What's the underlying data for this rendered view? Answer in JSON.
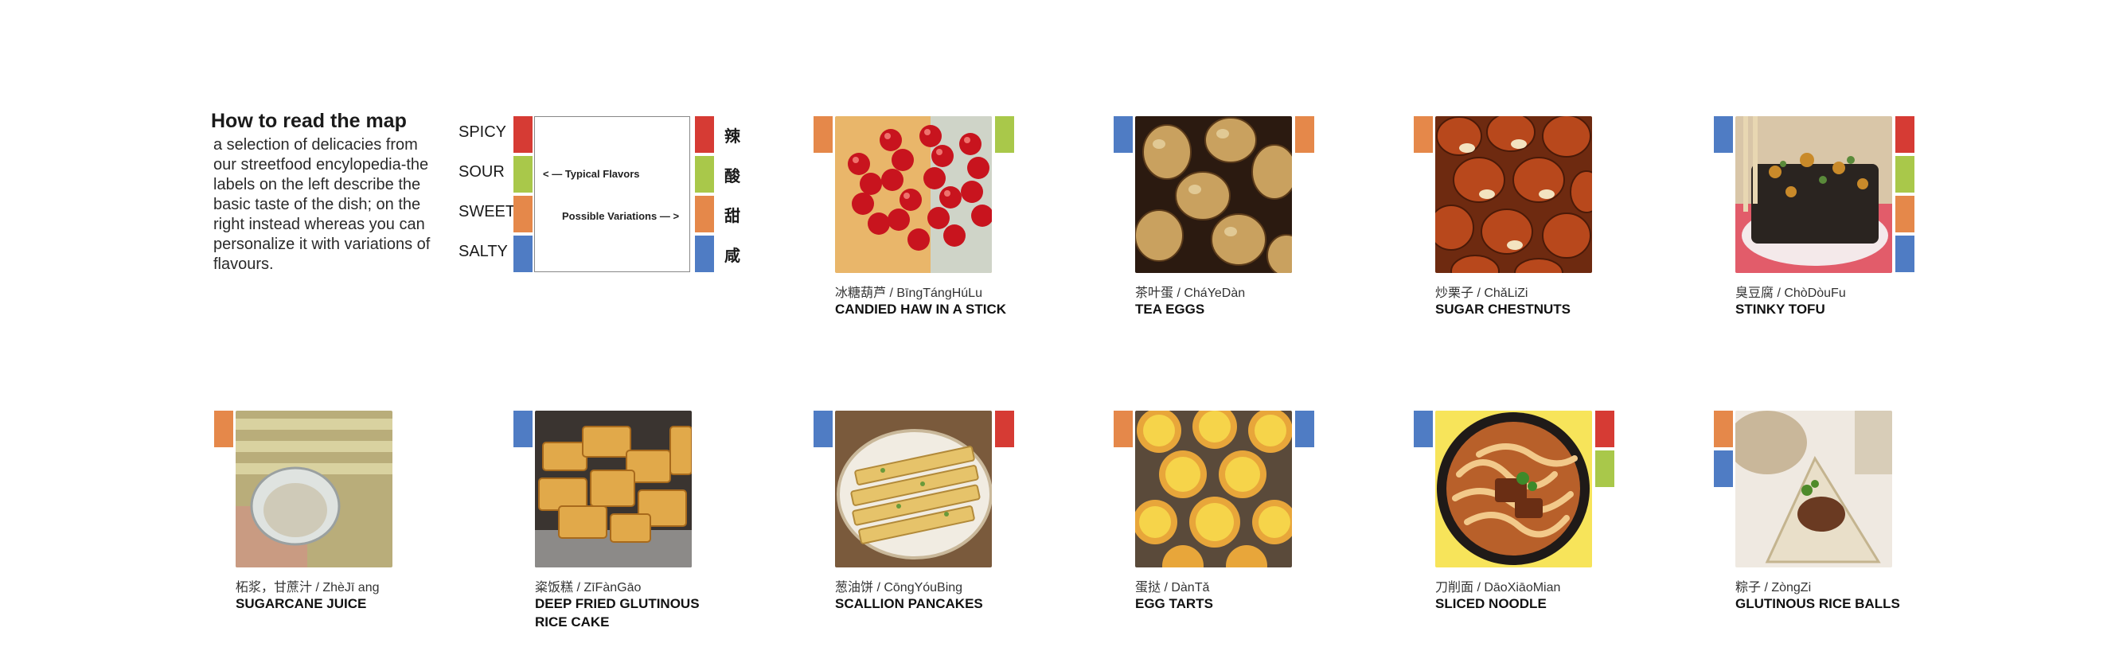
{
  "legend": {
    "title": "How to read the map",
    "description": "a selection of delicacies from our streetfood encylopedia-the labels on the left describe the basic taste of the dish; on the right instead whereas you can personalize it with variations of flavours.",
    "flavors": [
      "SPICY",
      "SOUR",
      "SWEET",
      "SALTY"
    ],
    "typical_label": "< — Typical Flavors",
    "variation_label": "Possible Variations — >",
    "chinese_chars": [
      "辣",
      "酸",
      "甜",
      "咸"
    ]
  },
  "colors": {
    "spicy": "#d63b34",
    "sour": "#a9c84a",
    "sweet": "#e5884a",
    "salty": "#4f7cc4"
  },
  "foods": [
    {
      "cn": "冰糖葫芦 / BīngTángHúLu",
      "en": "CANDIED HAW IN A STICK",
      "typical": [
        "sweet"
      ],
      "variations": [
        "sour"
      ],
      "image": "candied-haw-photo"
    },
    {
      "cn": "茶叶蛋 / CháYeDàn",
      "en": "TEA EGGS",
      "typical": [
        "salty"
      ],
      "variations": [
        "sweet"
      ],
      "image": "tea-eggs-photo"
    },
    {
      "cn": "炒栗子 / ChǎLiZi",
      "en": "SUGAR CHESTNUTS",
      "typical": [
        "sweet"
      ],
      "variations": [],
      "image": "chestnuts-photo"
    },
    {
      "cn": "臭豆腐 / ChòDòuFu",
      "en": "STINKY TOFU",
      "typical": [
        "salty"
      ],
      "variations": [
        "spicy",
        "sour",
        "sweet",
        "salty"
      ],
      "image": "stinky-tofu-photo"
    },
    {
      "cn": "柘浆，甘蔗汁 / ZhèJī ang",
      "en": "SUGARCANE JUICE",
      "typical": [
        "sweet"
      ],
      "variations": [],
      "image": "sugarcane-juice-photo"
    },
    {
      "cn": "粢饭糕 / ZīFànGāo",
      "en": "DEEP FRIED GLUTINOUS RICE CAKE",
      "typical": [
        "salty"
      ],
      "variations": [],
      "image": "rice-cake-photo"
    },
    {
      "cn": "葱油饼 / CōngYóuBing",
      "en": "SCALLION PANCAKES",
      "typical": [
        "salty"
      ],
      "variations": [
        "spicy"
      ],
      "image": "scallion-pancake-photo"
    },
    {
      "cn": "蛋挞 / DànTǎ",
      "en": "EGG TARTS",
      "typical": [
        "sweet"
      ],
      "variations": [
        "salty"
      ],
      "image": "egg-tarts-photo"
    },
    {
      "cn": "刀削面 / DāoXiāoMian",
      "en": "SLICED NOODLE",
      "typical": [
        "salty"
      ],
      "variations": [
        "spicy",
        "sour"
      ],
      "image": "sliced-noodle-photo"
    },
    {
      "cn": "粽子 / ZòngZi",
      "en": "GLUTINOUS RICE BALLS",
      "typical": [
        "sweet",
        "salty"
      ],
      "variations": [],
      "image": "rice-balls-photo"
    }
  ]
}
